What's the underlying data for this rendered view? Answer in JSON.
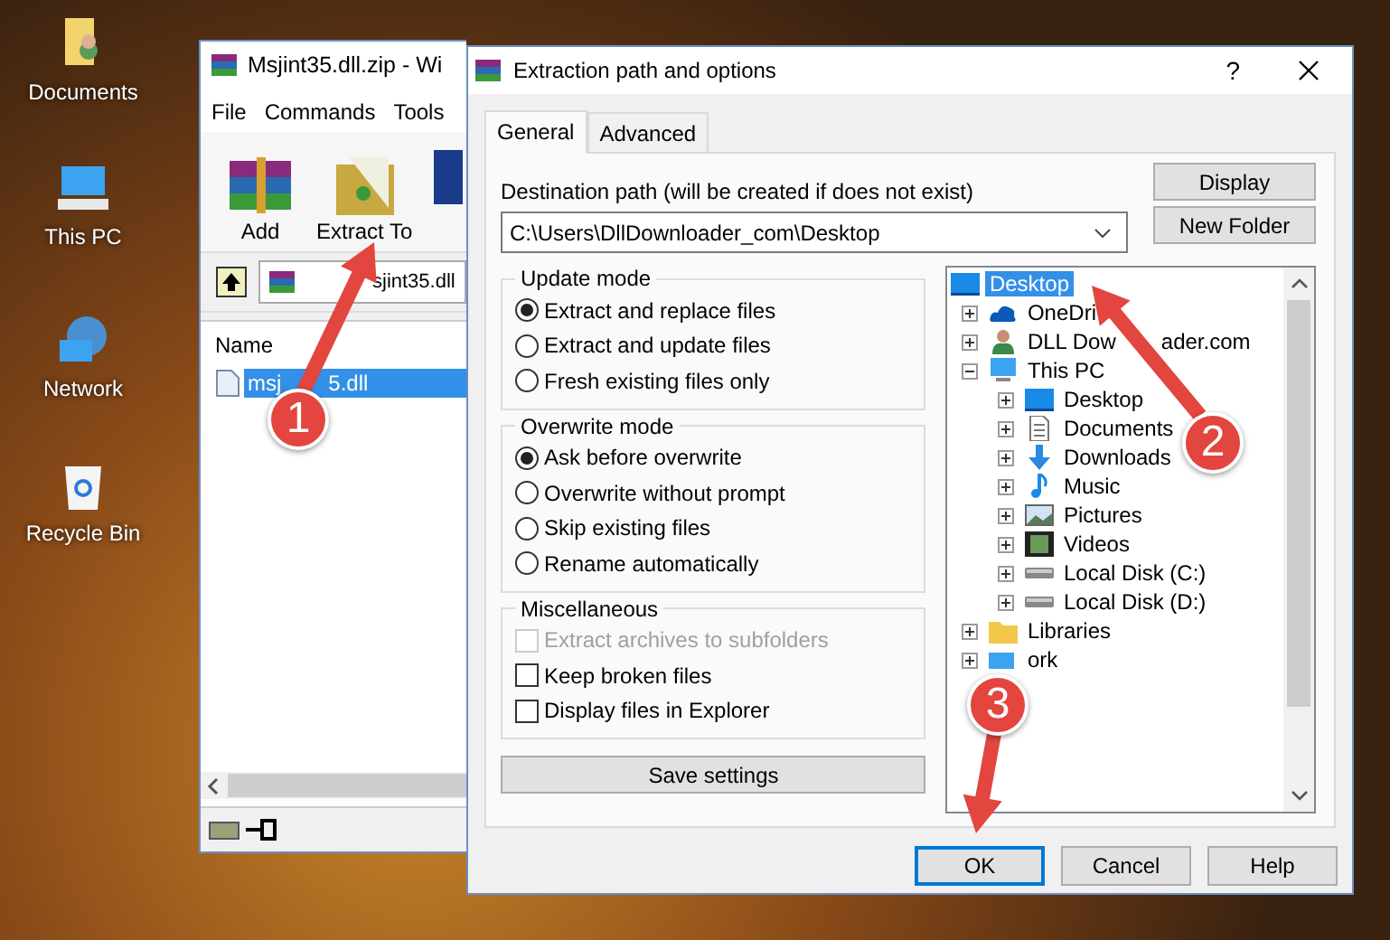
{
  "desktop_icons": [
    {
      "label": "Documents",
      "kind": "documents"
    },
    {
      "label": "This PC",
      "kind": "pc"
    },
    {
      "label": "Network",
      "kind": "network"
    },
    {
      "label": "Recycle Bin",
      "kind": "recycle"
    }
  ],
  "archiver": {
    "title": "Msjint35.dll.zip - Wi",
    "menu": [
      "File",
      "Commands",
      "Tools"
    ],
    "toolbar": [
      {
        "label": "Add",
        "kind": "add"
      },
      {
        "label": "Extract To",
        "kind": "extract"
      },
      {
        "kind": "partial"
      }
    ],
    "path_visible": "sjint35.dll",
    "column": "Name",
    "file": {
      "name_start": "msj",
      "name_end": "5.dll",
      "selected": true
    }
  },
  "dialog": {
    "title": "Extraction path and options",
    "help": "?",
    "tabs": [
      {
        "label": "General",
        "selected": true
      },
      {
        "label": "Advanced",
        "selected": false
      }
    ],
    "destination_label": "Destination path (will be created if does not exist)",
    "destination_value": "C:\\Users\\DllDownloader_com\\Desktop",
    "side_buttons": [
      "Display",
      "New Folder"
    ],
    "groups": [
      {
        "title": "Update mode",
        "options": [
          {
            "label": "Extract and replace files",
            "kind": "radio",
            "checked": true,
            "disabled": false
          },
          {
            "label": "Extract and update files",
            "kind": "radio",
            "checked": false,
            "disabled": false
          },
          {
            "label": "Fresh existing files only",
            "kind": "radio",
            "checked": false,
            "disabled": false
          }
        ]
      },
      {
        "title": "Overwrite mode",
        "options": [
          {
            "label": "Ask before overwrite",
            "kind": "radio",
            "checked": true,
            "disabled": false
          },
          {
            "label": "Overwrite without prompt",
            "kind": "radio",
            "checked": false,
            "disabled": false
          },
          {
            "label": "Skip existing files",
            "kind": "radio",
            "checked": false,
            "disabled": false
          },
          {
            "label": "Rename automatically",
            "kind": "radio",
            "checked": false,
            "disabled": false
          }
        ]
      },
      {
        "title": "Miscellaneous",
        "options": [
          {
            "label": "Extract archives to subfolders",
            "kind": "checkbox",
            "checked": false,
            "disabled": true
          },
          {
            "label": "Keep broken files",
            "kind": "checkbox",
            "checked": false,
            "disabled": false
          },
          {
            "label": "Display files in Explorer",
            "kind": "checkbox",
            "checked": false,
            "disabled": false
          }
        ]
      }
    ],
    "save_button": "Save settings",
    "tree": [
      {
        "label": "Desktop",
        "kind": "monitor",
        "selected": true,
        "children": [
          {
            "label": "OneDri",
            "kind": "cloud",
            "selected": false,
            "expanded": false
          },
          {
            "label": "DLL Dow",
            "label_end": "ader.com",
            "kind": "person",
            "selected": false,
            "expanded": false
          },
          {
            "label": "This PC",
            "kind": "pc",
            "selected": false,
            "expanded": true,
            "children": [
              {
                "label": "Desktop",
                "kind": "monitor",
                "selected": false,
                "expanded": false
              },
              {
                "label": "Documents",
                "kind": "document",
                "selected": false,
                "expanded": false
              },
              {
                "label": "Downloads",
                "kind": "download",
                "selected": false,
                "expanded": false
              },
              {
                "label": "Music",
                "kind": "music",
                "selected": false,
                "expanded": false
              },
              {
                "label": "Pictures",
                "kind": "picture",
                "selected": false,
                "expanded": false
              },
              {
                "label": "Videos",
                "kind": "video",
                "selected": false,
                "expanded": false
              },
              {
                "label": "Local Disk (C:)",
                "kind": "disk",
                "selected": false,
                "expanded": false
              },
              {
                "label": "Local Disk (D:)",
                "kind": "disk",
                "selected": false,
                "expanded": false
              }
            ]
          },
          {
            "label": "Libraries",
            "kind": "folder",
            "selected": false,
            "expanded": false
          },
          {
            "label": "ork",
            "kind": "network",
            "selected": false,
            "expanded": false
          }
        ]
      }
    ],
    "buttons": [
      {
        "label": "OK",
        "default": true
      },
      {
        "label": "Cancel",
        "default": false
      },
      {
        "label": "Help",
        "default": false
      }
    ]
  },
  "callouts": [
    {
      "number": "1"
    },
    {
      "number": "2"
    },
    {
      "number": "3"
    }
  ]
}
